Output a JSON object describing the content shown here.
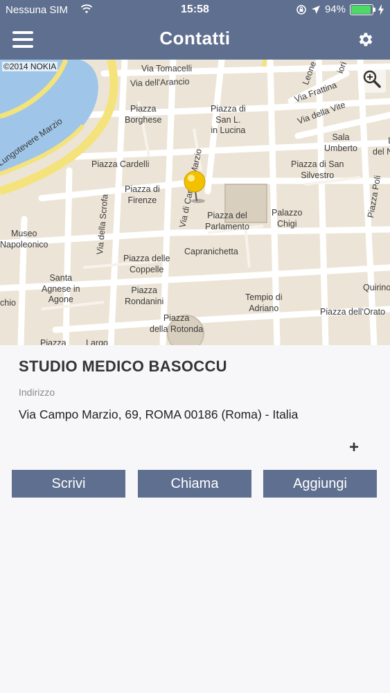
{
  "status_bar": {
    "carrier": "Nessuna SIM",
    "time": "15:58",
    "battery_percent": "94%",
    "battery_level": 0.94
  },
  "header": {
    "title": "Contatti"
  },
  "map": {
    "copyright": "©2014 NOKIA",
    "labels": {
      "via_tomacelli": "Via Tomacelli",
      "via_arancio": "Via dell'Arancio",
      "leone": "Leone",
      "ori": "iori",
      "via_frattina": "Via Frattina",
      "via_della_vite": "Via della Vite",
      "piazza_borghese": "Piazza\nBorghese",
      "piazza_san_lucina": "Piazza di\nSan L.\nin Lucina",
      "sala_umberto": "Sala\nUmberto",
      "del_n": "L\ndel N",
      "lungotevere": "Lungotevere Marzio",
      "piazza_cardelli": "Piazza Cardelli",
      "via_campo_marzio": "Via di Campo Marzio",
      "piazza_san_silvestro": "Piazza di San\nSilvestro",
      "piazza_poli": "Piazza Poli",
      "piazza_firenze": "Piazza di\nFirenze",
      "via_della_scrofa": "Via della Scrofa",
      "piazza_parlamento": "Piazza del\nParlamento",
      "palazzo_chigi": "Palazzo\nChigi",
      "museo_napoleonico": "Museo\nNapoleonico",
      "capranichetta": "Capranichetta",
      "piazza_coppelle": "Piazza delle\nCoppelle",
      "santa_agnese": "Santa\nAgnese in\nAgone",
      "chio": "chio",
      "piazza_rondanini": "Piazza\nRondanini",
      "tempio_adriano": "Tempio di\nAdriano",
      "quirino": "Quirino",
      "piazza_oratorio": "Piazza dell'Orato",
      "piazza_rotonda": "Piazza\ndella Rotonda",
      "piazza_bottom": "Piazza",
      "largo_bottom": "Largo"
    }
  },
  "contact": {
    "name": "STUDIO MEDICO BASOCCU",
    "address_label": "Indirizzo",
    "address": "Via Campo Marzio, 69, ROMA 00186 (Roma) - Italia",
    "more_symbol": "+"
  },
  "actions": {
    "write": "Scrivi",
    "call": "Chiama",
    "add": "Aggiungi"
  },
  "colors": {
    "navbar": "#5f6f8f",
    "button": "#5f6f8f",
    "map_land": "#ece4d6",
    "river": "#9fc6e8",
    "pin": "#f2c200"
  }
}
